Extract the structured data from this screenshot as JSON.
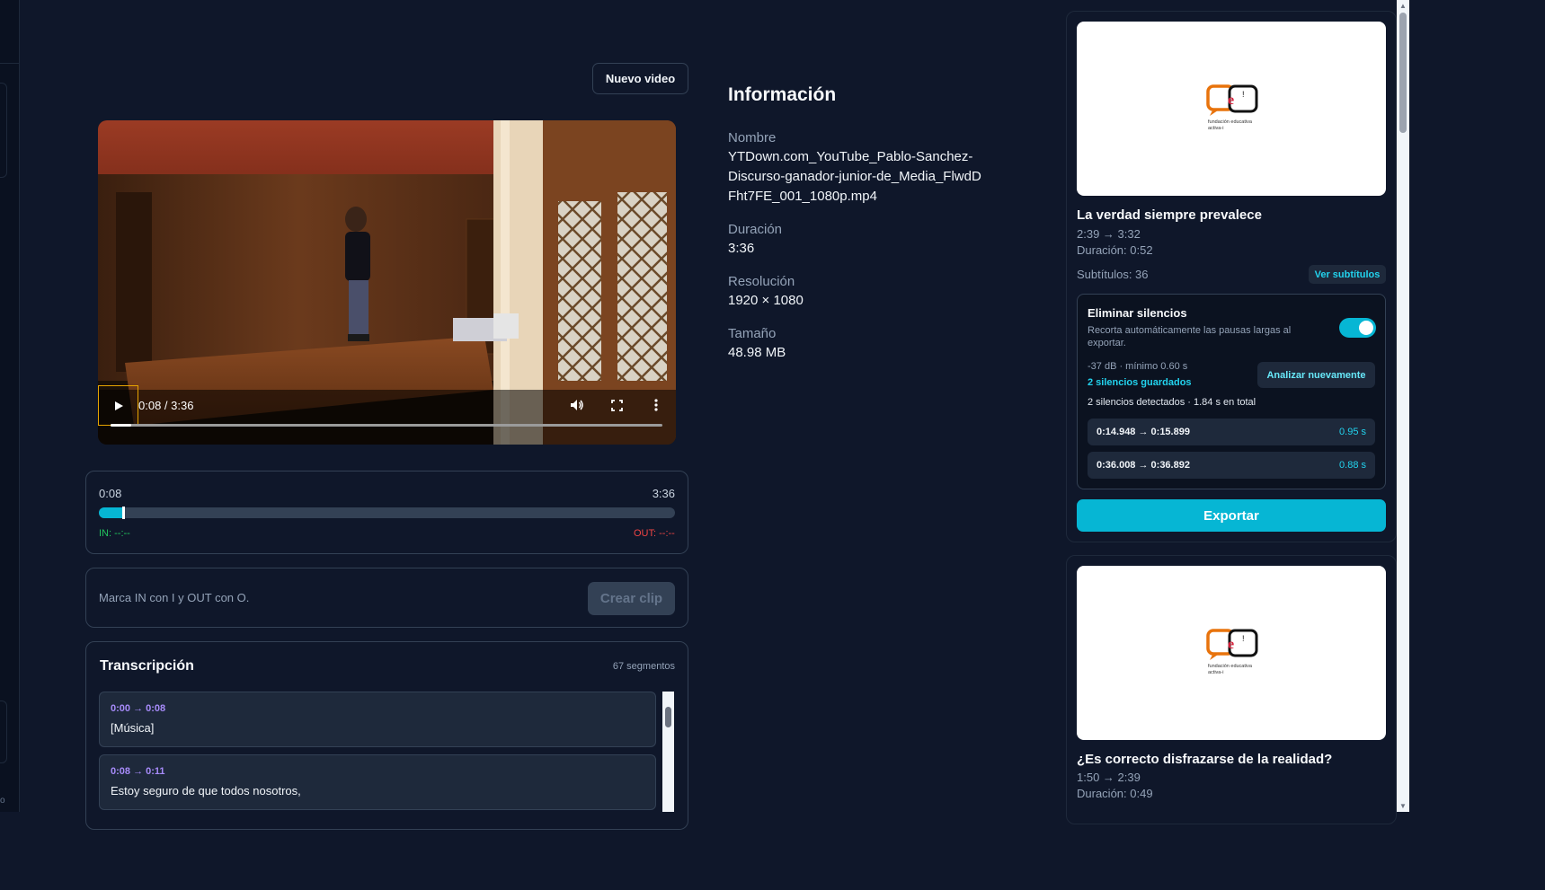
{
  "toolbar": {
    "new_video_label": "Nuevo video"
  },
  "player": {
    "time_display": "0:08 / 3:36",
    "progress_fraction": 0.037,
    "icons": [
      "play-icon",
      "volume-icon",
      "fullscreen-icon",
      "more-vert-icon"
    ]
  },
  "range": {
    "start_label": "0:08",
    "end_label": "3:36",
    "fill_fraction": 0.04,
    "in_label": "IN: --:--",
    "out_label": "OUT: --:--"
  },
  "clip_form": {
    "hint": "Marca IN con I y OUT con O.",
    "create_label": "Crear clip"
  },
  "transcript": {
    "title": "Transcripción",
    "count": "67 segmentos",
    "segments": [
      {
        "time": "0:00 → 0:08",
        "text": "[Música]"
      },
      {
        "time": "0:08 → 0:11",
        "text": "Estoy seguro de que todos nosotros,"
      }
    ]
  },
  "info": {
    "title": "Información",
    "name_label": "Nombre",
    "name_value": "YTDown.com_YouTube_Pablo-Sanchez-Discurso-ganador-junior-de_Media_FlwdDFht7FE_001_1080p.mp4",
    "duration_label": "Duración",
    "duration_value": "3:36",
    "resolution_label": "Resolución",
    "resolution_value": "1920 × 1080",
    "size_label": "Tamaño",
    "size_value": "48.98 MB"
  },
  "clips": [
    {
      "title": "La verdad siempre prevalece",
      "range": "2:39 → 3:32",
      "duration": "Duración: 0:52",
      "subtitles": "Subtítulos: 36",
      "subtitles_button": "Ver subtítulos",
      "logo_text": "fundación educativa activa-i"
    },
    {
      "title": "¿Es correcto disfrazarse de la realidad?",
      "range": "1:50 → 2:39",
      "duration": "Duración: 0:49",
      "logo_text": "fundación educativa activa-i"
    }
  ],
  "silence": {
    "title": "Eliminar silencios",
    "description": "Recorta automáticamente las pausas largas al exportar.",
    "enabled": true,
    "params": "-37 dB · mínimo 0.60 s",
    "saved": "2 silencios guardados",
    "analyze_label": "Analizar nuevamente",
    "summary": "2 silencios detectados · 1.84 s en total",
    "items": [
      {
        "range": "0:14.948 → 0:15.899",
        "duration": "0.95 s"
      },
      {
        "range": "0:36.008 → 0:36.892",
        "duration": "0.88 s"
      }
    ]
  },
  "export_label": "Exportar",
  "colors": {
    "accent": "#06b6d4",
    "background": "#0f172a",
    "in": "#22c55e",
    "out": "#ef4444",
    "segment_time": "#a78bfa"
  }
}
